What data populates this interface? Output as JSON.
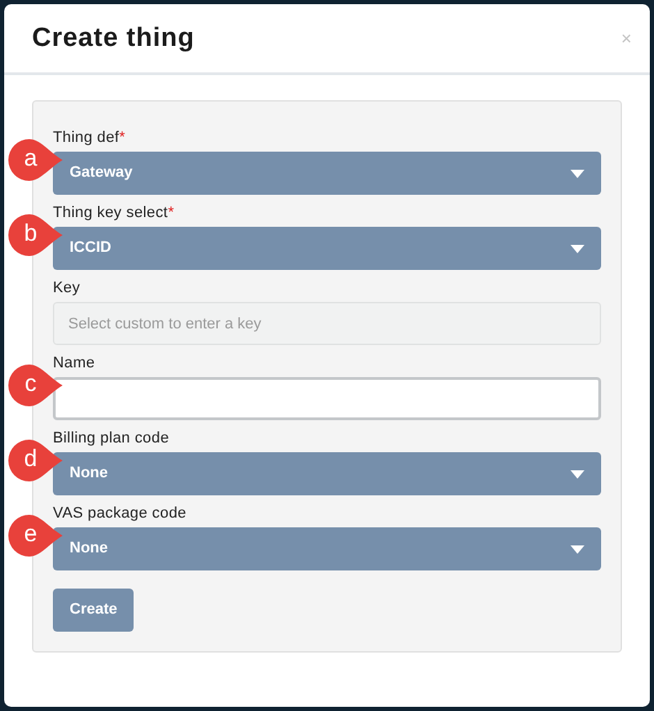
{
  "dialog": {
    "title": "Create thing",
    "close": "×"
  },
  "fields": [
    {
      "kind": "select",
      "label": "Thing def",
      "required_mark": "*",
      "value": "Gateway",
      "callout": "a"
    },
    {
      "kind": "select",
      "label": "Thing key select",
      "required_mark": "*",
      "value": "ICCID",
      "callout": "b"
    },
    {
      "kind": "input",
      "label": "Key",
      "placeholder": "Select custom to enter a key",
      "disabled": true
    },
    {
      "kind": "input",
      "label": "Name",
      "disabled": false,
      "callout": "c"
    },
    {
      "kind": "select",
      "label": "Billing plan code",
      "value": "None",
      "callout": "d"
    },
    {
      "kind": "select",
      "label": "VAS package code",
      "value": "None",
      "callout": "e"
    }
  ],
  "submit": "Create"
}
